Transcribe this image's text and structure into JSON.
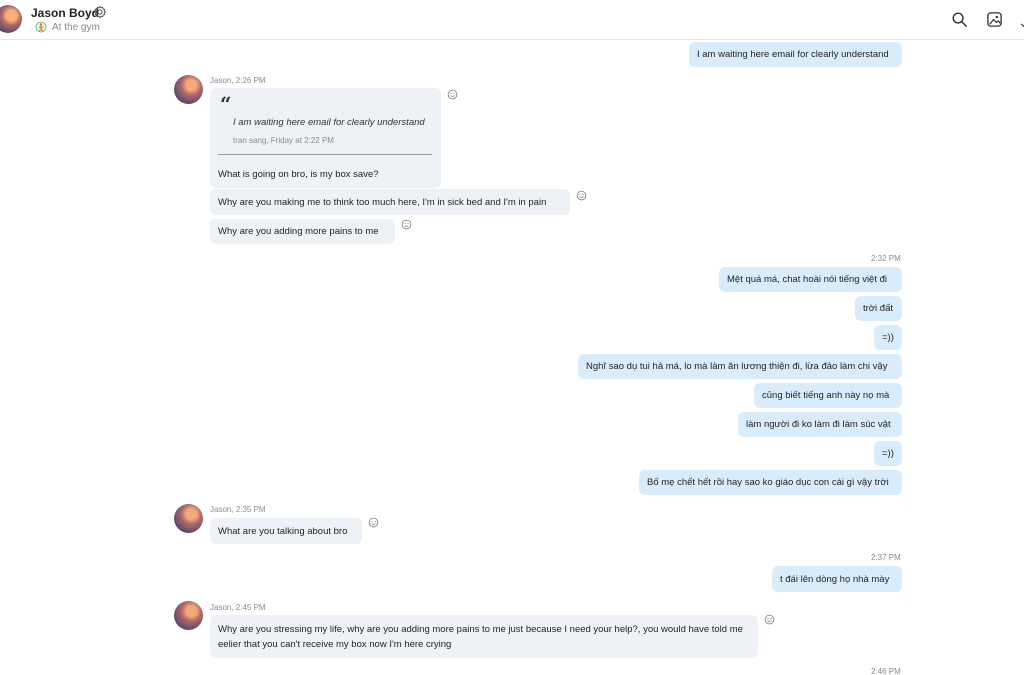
{
  "header": {
    "contact_name": "Jason Boyd",
    "status_text": "At the gym",
    "icons": [
      "gear-icon",
      "status-icon",
      "search-icon",
      "gallery-icon",
      "more-icon"
    ]
  },
  "messages": {
    "m1": "I am waiting here email for clearly understand",
    "sender1": "Jason, 2:26 PM",
    "quote_mark": "“",
    "quote_text": "I am waiting here email for clearly understand",
    "quote_meta": "tran sang, Friday at 2:22 PM",
    "quote_reply": "What is going on bro, is my box save?",
    "m2": "Why are you making me to think too much here, I'm in sick bed and I'm in pain",
    "m3": "Why are you adding more pains to me",
    "time1": "2:32 PM",
    "m4": "Mệt quá má, chat hoài nói tiếng việt đi",
    "m5": "trời đất",
    "m6": "=))",
    "m7": "Nghĩ sao dụ tui hả má, lo mà làm ăn lương thiện đi, lừa đảo làm chi vậy",
    "m8": "củng biết tiếng anh này nọ mà",
    "m9": "làm người đi ko làm đi làm súc vật",
    "m10": "=))",
    "m11": "Bố mẹ chết hết rồi hay sao ko giáo dục con cái gì vậy trời",
    "sender2": "Jason, 2:35 PM",
    "m12": "What are you talking about bro",
    "time2": "2:37 PM",
    "m13": "t đái lên dòng họ nhà mày",
    "sender3": "Jason, 2:45 PM",
    "m14": "Why are you stressing my life, why are you adding more pains to me just because I need your help?, you would have told me eelier that you can't receive my box now I'm here crying",
    "time3": "2:46 PM"
  }
}
